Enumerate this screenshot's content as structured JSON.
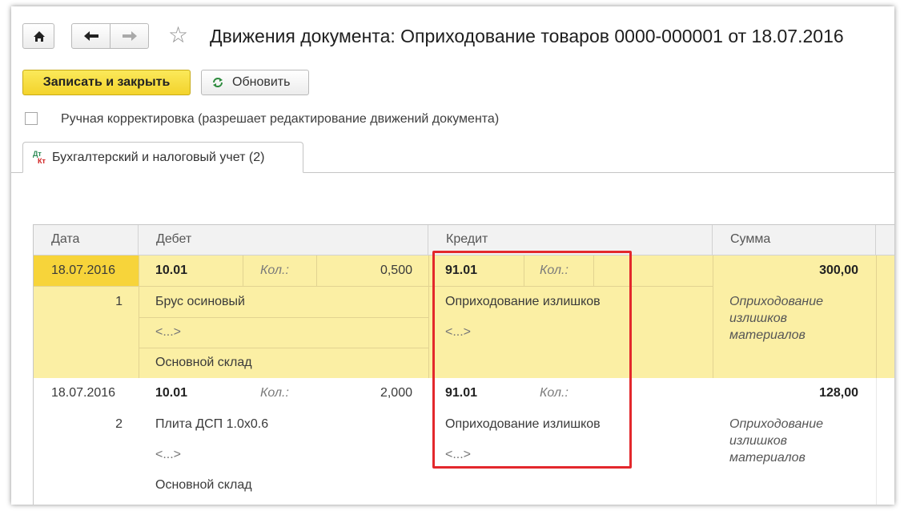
{
  "window": {
    "title": "Движения документа: Оприходование товаров 0000-000001 от 18.07.2016"
  },
  "nav": {
    "home_icon": "home-icon",
    "back_icon": "arrow-left-icon",
    "forward_icon": "arrow-right-icon",
    "favorite_icon": "star-icon"
  },
  "toolbar": {
    "save_close_label": "Записать и закрыть",
    "refresh_label": "Обновить"
  },
  "manual_edit": {
    "label": "Ручная корректировка (разрешает редактирование движений документа)",
    "checked": false
  },
  "tab": {
    "icon_top": "Дт",
    "icon_bottom": "Кт",
    "label": "Бухгалтерский и налоговый учет (2)"
  },
  "table": {
    "columns": [
      "Дата",
      "Дебет",
      "Кредит",
      "Сумма"
    ],
    "rows": [
      {
        "date": "18.07.2016",
        "num": "1",
        "debit_account": "10.01",
        "debit_qty_label": "Кол.:",
        "debit_qty": "0,500",
        "debit_sub1": "Брус осиновый",
        "debit_sub2": "<...>",
        "debit_sub3": "Основной склад",
        "credit_account": "91.01",
        "credit_qty_label": "Кол.:",
        "credit_sub1": "Оприходование излишков",
        "credit_sub2": "<...>",
        "amount": "300,00",
        "comment_l1": "Оприходование",
        "comment_l2": "излишков",
        "comment_l3": "материалов"
      },
      {
        "date": "18.07.2016",
        "num": "2",
        "debit_account": "10.01",
        "debit_qty_label": "Кол.:",
        "debit_qty": "2,000",
        "debit_sub1": "Плита ДСП 1.0x0.6",
        "debit_sub2": "<...>",
        "debit_sub3": "Основной склад",
        "credit_account": "91.01",
        "credit_qty_label": "Кол.:",
        "credit_sub1": "Оприходование излишков",
        "credit_sub2": "<...>",
        "amount": "128,00",
        "comment_l1": "Оприходование",
        "comment_l2": "излишков",
        "comment_l3": "материалов"
      }
    ]
  },
  "colors": {
    "selected_row": "#fbefa4",
    "highlight_box": "#e3282c",
    "primary_button": "#f3d32c"
  }
}
